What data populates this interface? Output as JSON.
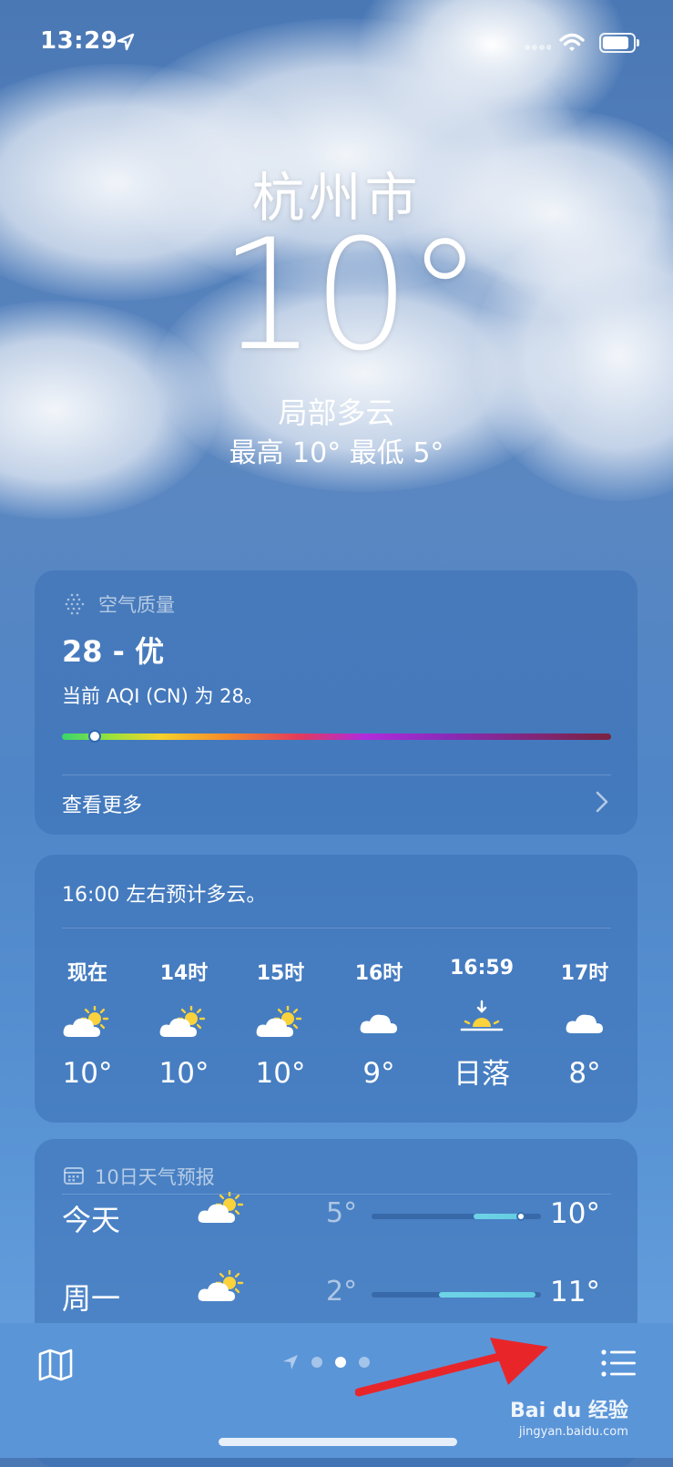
{
  "status_bar": {
    "time": "13:29"
  },
  "header": {
    "city": "杭州市",
    "temperature": "10°",
    "condition": "局部多云",
    "high_low": "最高 10°  最低 5°"
  },
  "air_quality": {
    "section_label": "空气质量",
    "value": "28 - 优",
    "description": "当前 AQI (CN) 为 28。",
    "scale_position": 0.06,
    "see_more": "查看更多"
  },
  "hourly": {
    "summary": "16:00 左右预计多云。",
    "items": [
      {
        "time": "现在",
        "icon": "partly-sunny-icon",
        "temp": "10°"
      },
      {
        "time": "14时",
        "icon": "partly-sunny-icon",
        "temp": "10°"
      },
      {
        "time": "15时",
        "icon": "partly-sunny-icon",
        "temp": "10°"
      },
      {
        "time": "16时",
        "icon": "cloud-icon",
        "temp": "9°"
      },
      {
        "time": "16:59",
        "icon": "sunset-icon",
        "temp": "日落"
      },
      {
        "time": "17时",
        "icon": "cloud-icon",
        "temp": "8°"
      }
    ]
  },
  "ten_day": {
    "section_label": "10日天气预报",
    "rows": [
      {
        "day": "今天",
        "icon": "partly-sunny-icon",
        "low": "5°",
        "high": "10°",
        "range_start": 0.6,
        "range_end": 0.88,
        "current": 0.88
      },
      {
        "day": "周一",
        "icon": "partly-sunny-icon",
        "low": "2°",
        "high": "11°",
        "range_start": 0.4,
        "range_end": 0.97
      }
    ]
  },
  "toolbar": {
    "page_count": 3,
    "active_page": 1
  },
  "watermark": {
    "brand": "Bai du 经验",
    "url": "jingyan.baidu.com"
  },
  "colors": {
    "annotation_arrow": "#e8262a",
    "range_bar": "#63cde0"
  }
}
